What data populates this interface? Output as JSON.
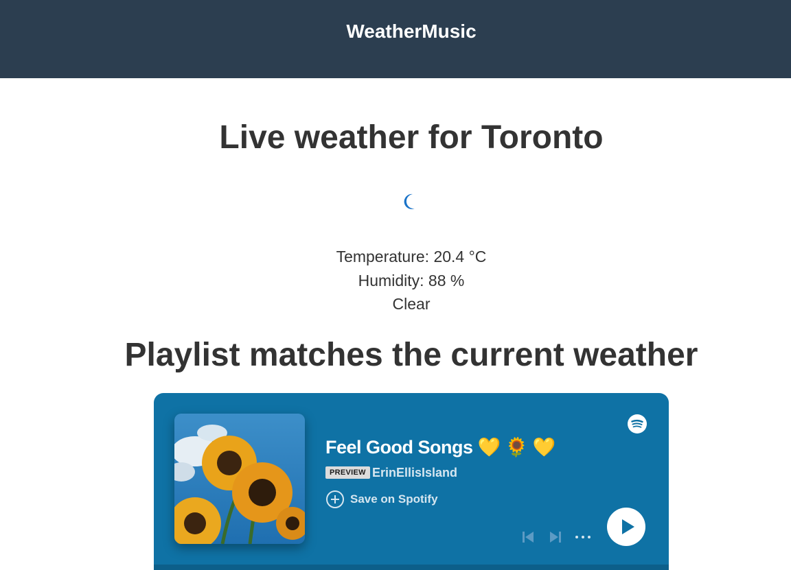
{
  "header": {
    "brand": "WeatherMusic",
    "background_color": "#2c3e50"
  },
  "weather": {
    "title": "Live weather for Toronto",
    "icon": "crescent-moon-icon",
    "icon_color": "#1a73c8",
    "temperature": "Temperature: 20.4 °C",
    "humidity": "Humidity: 88 %",
    "condition": "Clear"
  },
  "playlist_section": {
    "title": "Playlist matches the current weather"
  },
  "spotify_embed": {
    "background_color": "#0f72a5",
    "cover_icon": "sunflower-cover-image",
    "playlist_name": "Feel Good Songs 💛 🌻 💛",
    "badge": "PREVIEW",
    "owner": "ErinEllisIsland",
    "save_label": "Save on Spotify",
    "icons": {
      "logo": "spotify-logo-icon",
      "save": "plus-circle-icon",
      "previous": "skip-previous-icon",
      "next": "skip-next-icon",
      "more": "more-options-icon",
      "play": "play-icon"
    }
  }
}
